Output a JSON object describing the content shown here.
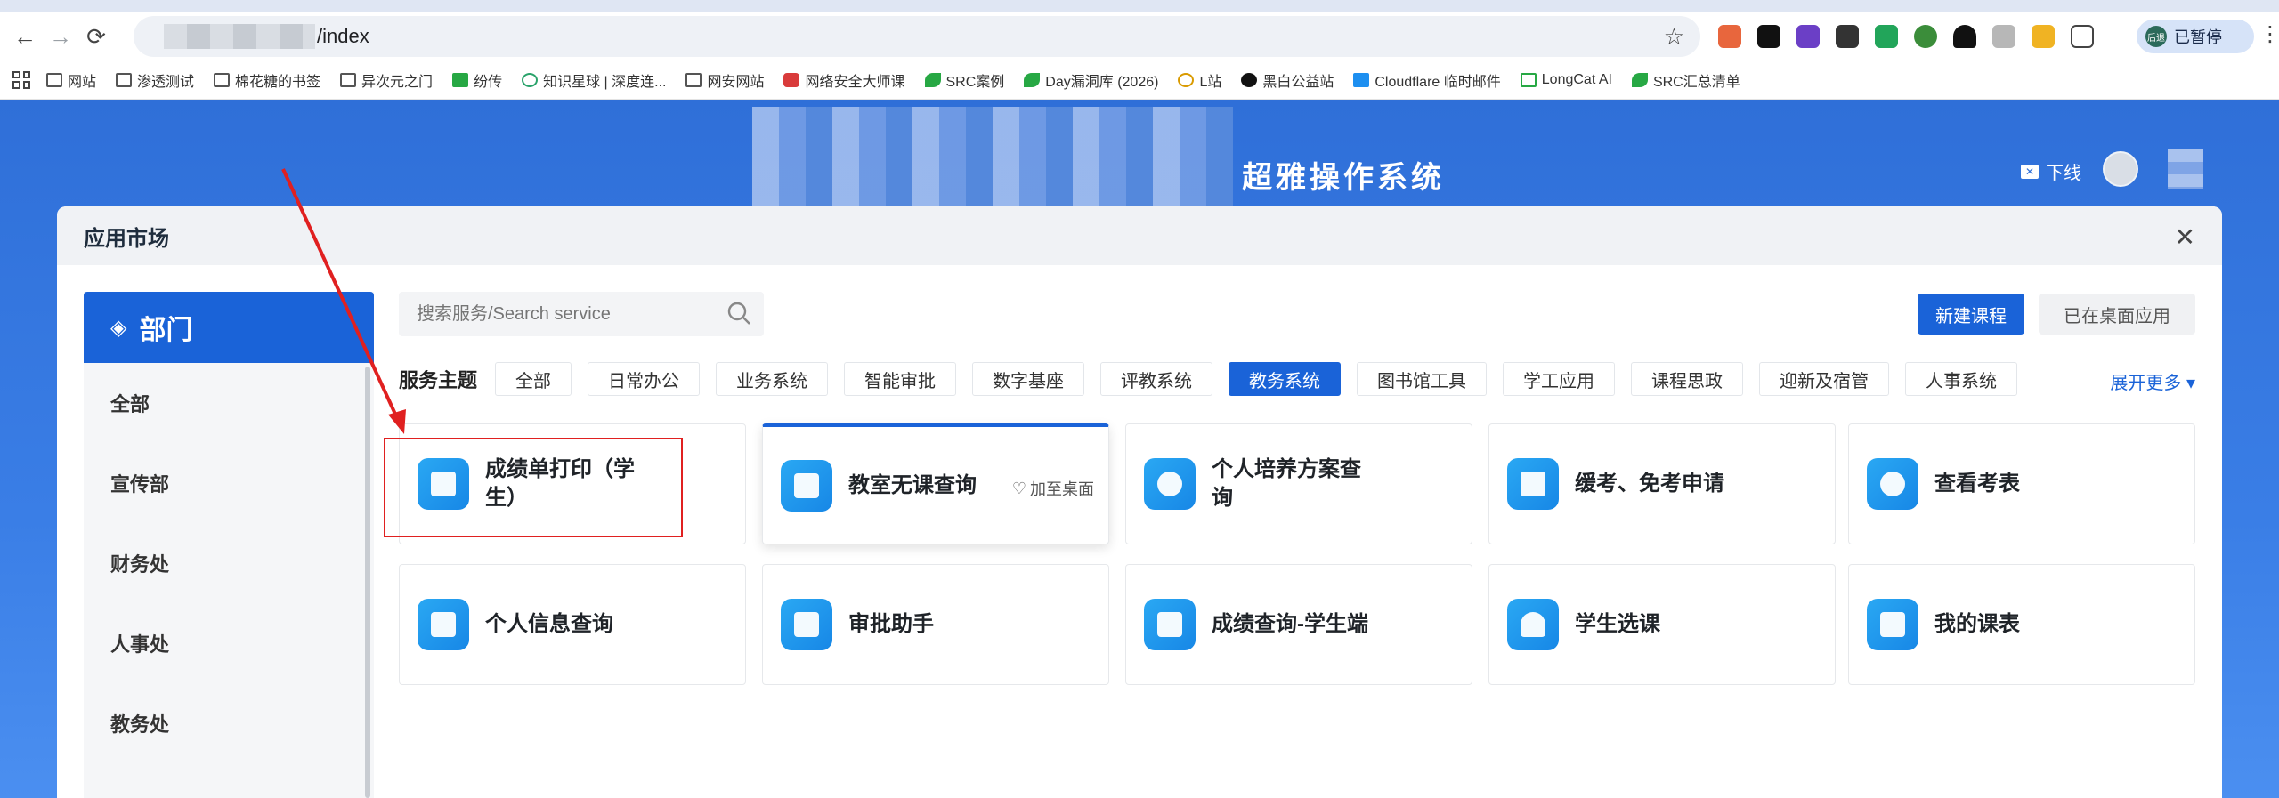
{
  "browser": {
    "url_suffix": "/index",
    "paused_label": "已暂停",
    "avatar_badge": "后退",
    "bookmarks": [
      {
        "label": "网站",
        "icon": "folder-icon"
      },
      {
        "label": "渗透测试",
        "icon": "folder-icon"
      },
      {
        "label": "棉花糖的书签",
        "icon": "folder-icon"
      },
      {
        "label": "异次元之门",
        "icon": "folder-icon"
      },
      {
        "label": "纷传",
        "icon": "green-square-icon"
      },
      {
        "label": "知识星球 | 深度连...",
        "icon": "circle-icon"
      },
      {
        "label": "网安网站",
        "icon": "folder-icon"
      },
      {
        "label": "网络安全大师课",
        "icon": "shield-icon"
      },
      {
        "label": "SRC案例",
        "icon": "leaf-icon"
      },
      {
        "label": "Day漏洞库 (2026)",
        "icon": "leaf-icon"
      },
      {
        "label": "L站",
        "icon": "circle-icon"
      },
      {
        "label": "黑白公益站",
        "icon": "black-circle-icon"
      },
      {
        "label": "Cloudflare 临时邮件",
        "icon": "mail-icon"
      },
      {
        "label": "LongCat AI",
        "icon": "cat-icon"
      },
      {
        "label": "SRC汇总清单",
        "icon": "leaf-icon"
      }
    ]
  },
  "app": {
    "system_title": "超雅操作系统",
    "logout_label": "下线"
  },
  "modal": {
    "title": "应用市场",
    "close_icon": "close-icon"
  },
  "sidebar": {
    "header": "部门",
    "items": [
      "全部",
      "宣传部",
      "财务处",
      "人事处",
      "教务处"
    ]
  },
  "toolbar": {
    "search_placeholder": "搜索服务/Search service",
    "new_course": "新建课程",
    "on_desktop": "已在桌面应用"
  },
  "filters": {
    "label": "服务主题",
    "tags": [
      "全部",
      "日常办公",
      "业务系统",
      "智能审批",
      "数字基座",
      "评教系统",
      "教务系统",
      "图书馆工具",
      "学工应用",
      "课程思政",
      "迎新及宿管",
      "人事系统"
    ],
    "active_index": 6,
    "expand": "展开更多"
  },
  "cards": [
    {
      "title": "成绩单打印（学生）",
      "icon": "print-icon"
    },
    {
      "title": "教室无课查询",
      "icon": "list-icon",
      "action": "加至桌面"
    },
    {
      "title": "个人培养方案查询",
      "icon": "globe-icon"
    },
    {
      "title": "缓考、免考申请",
      "icon": "form-icon"
    },
    {
      "title": "查看考表",
      "icon": "people-icon"
    },
    {
      "title": "个人信息查询",
      "icon": "chat-icon"
    },
    {
      "title": "审批助手",
      "icon": "monitor-icon"
    },
    {
      "title": "成绩查询-学生端",
      "icon": "presentation-icon"
    },
    {
      "title": "学生选课",
      "icon": "user-icon"
    },
    {
      "title": "我的课表",
      "icon": "book-icon"
    }
  ],
  "colors": {
    "primary": "#1a63d8",
    "annotation": "#e02020"
  }
}
